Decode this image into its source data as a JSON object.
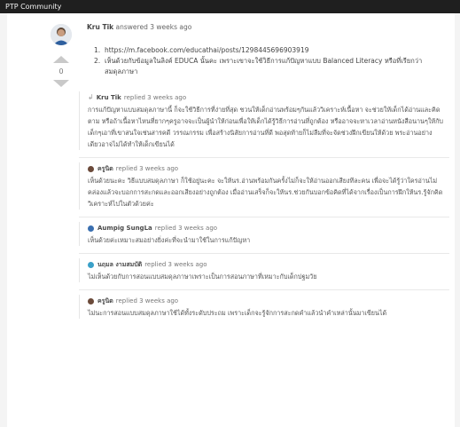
{
  "header": {
    "title": "PTP Community"
  },
  "answer": {
    "author": "Kru Tik",
    "meta": "answered 3 weeks ago",
    "vote_count": "0",
    "items": [
      {
        "num": "1.",
        "text": "https://m.facebook.com/educathai/posts/1298445696903919"
      },
      {
        "num": "2.",
        "text": "เห็นด้วยกับข้อมูลในลิงค์ EDUCA นั้นคะ เพราะเขาจะใช้วิธีการแก้ปัญหาแบบ Balanced Literacy หรือที่เรียกว่า สมดุลภาษา"
      }
    ]
  },
  "replies": [
    {
      "avatar": "reply-icon",
      "author": "Kru Tik",
      "meta": "replied 3 weeks ago",
      "body": "การแก้ปัญหาแบบสมดุลภาษานี้ ก็จะใช้วิธีการที่ง่ายที่สุด ชวนให้เด็กอ่านพร้อมๆกันแล้ววิเคราะห์เนื้อหา จะช่วยให้เด็กได้อ่านและคิดตาม หรือถ้าเนื้อหาไหนที่ยากๆครูอาจจะเป็นผู้นำให้ก่อนเพื่อให้เด็กได้รู้วิธีการอ่านที่ถูกต้อง หรืออาจจะหาเวลาอ่านหนังสือนานๆให้กับเด็กๆเอาที่เขาสนใจเช่นสารคดี วรรณกรรม เพื่อสร้างนิสัยการอ่านที่ดี พอสุดท้ายก็ไม่ลืมที่จะจัดช่วงฝึกเขียนให้ด้วย พระอ่านอย่างเดียวอาจไม่ได้ทำให้เด็กเขียนได้"
    },
    {
      "avatar": "user-avatar-brown",
      "author": "ครูนิด",
      "meta": "replied 3 weeks ago",
      "body": "เห็นด้วยนะคะ วิธีแบบสมดุลภาษา ก็ใช้อยู่นะคะ จะให้นร.อ่านพร้อมกันครั้งไม่ก็จะให้อ่านออกเสียงทีละคน เพื่อจะได้รู้ว่าใครอ่านไม่คล่องแล้วจะบอกการสะกดและออกเสียงอย่างถูกต้อง เมื่ออ่านเสร็จก็จะให้นร.ช่วยกันบอกข้อคิดที่ได้จากเรื่องเป็นการฝึกให้นร.รู้จักคิดวิเคราะห์ไปในตัวด้วยค่ะ"
    },
    {
      "avatar": "user-avatar-blue",
      "author": "Aumpig SungLa",
      "meta": "replied 3 weeks ago",
      "body": "เห็นด้วยค่ะเหมาะสมอย่างยิ่งค่ะที่จะนำมาใช้ในการแก้ปัญหา"
    },
    {
      "avatar": "user-avatar-teal",
      "author": "นฤมล งามสมบัติ",
      "meta": "replied 3 weeks ago",
      "body": "ไม่เห็นด้วยกับการสอนแบบสมดุลภาษาเพราะเป็นการสอนภาษาที่เหมาะกับเด็กปฐมวัย"
    },
    {
      "avatar": "user-avatar-brown",
      "author": "ครูนิด",
      "meta": "replied 3 weeks ago",
      "body": "ไม่นะการสอนแบบสมดุลภาษาใช้ได้ทั้งระดับประถม เพราะเด็กจะรู้จักการสะกดคำแล้วนำคำเหล่านั้นมาเขียนได้"
    }
  ]
}
